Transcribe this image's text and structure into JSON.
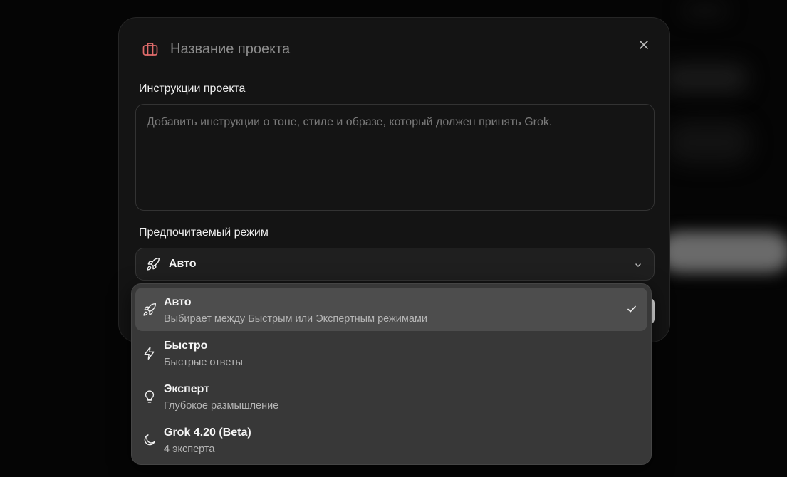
{
  "modal": {
    "title": "Название проекта",
    "title_icon": "briefcase-icon",
    "accent_color": "#e06b6b",
    "close_icon": "close-icon"
  },
  "instructions": {
    "label": "Инструкции проекта",
    "placeholder": "Добавить инструкции о тоне, стиле и образе, который должен принять Grok.",
    "value": ""
  },
  "mode": {
    "label": "Предпочитаемый режим",
    "selected": "Авто",
    "selected_icon": "rocket-icon",
    "options": [
      {
        "title": "Авто",
        "description": "Выбирает между Быстрым или Экспертным режимами",
        "icon": "rocket-icon",
        "selected": true
      },
      {
        "title": "Быстро",
        "description": "Быстрые ответы",
        "icon": "lightning-icon",
        "selected": false
      },
      {
        "title": "Эксперт",
        "description": "Глубокое размышление",
        "icon": "lightbulb-icon",
        "selected": false
      },
      {
        "title": "Grok 4.20 (Beta)",
        "description": "4 эксперта",
        "icon": "moon-icon",
        "selected": false
      }
    ]
  }
}
